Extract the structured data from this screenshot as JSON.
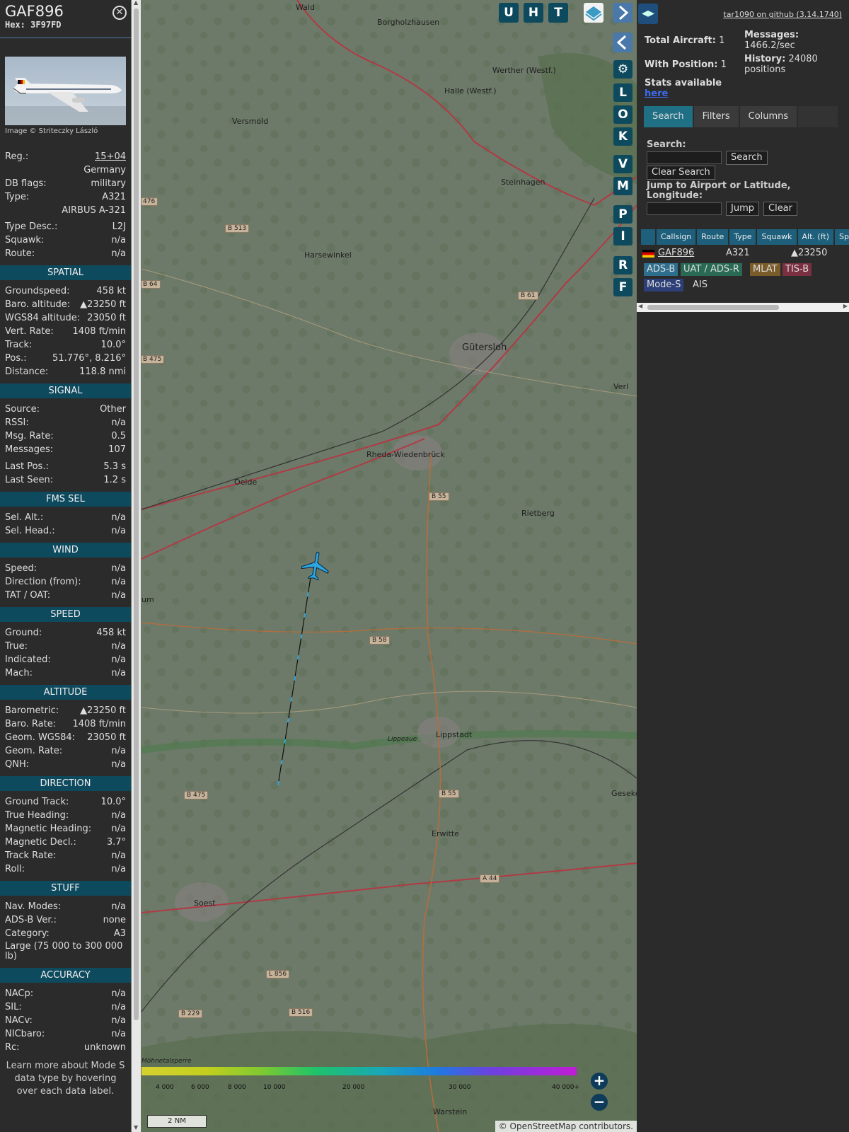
{
  "aircraft": {
    "callsign": "GAF896",
    "hex_label": "Hex:",
    "hex": "3F97FD",
    "photo_credit": "Image © Striteczky László"
  },
  "basic": [
    {
      "label": "Reg.:",
      "value": "15+04"
    },
    {
      "label": "",
      "value": "Germany"
    },
    {
      "label": "DB flags:",
      "value": "military"
    },
    {
      "label": "Type:",
      "value": "A321"
    },
    {
      "label": "",
      "value": "AIRBUS A-321"
    },
    {
      "label": "Type Desc.:",
      "value": "L2J"
    },
    {
      "label": "Squawk:",
      "value": "n/a"
    },
    {
      "label": "Route:",
      "value": "n/a"
    }
  ],
  "sections": [
    {
      "title": "SPATIAL",
      "rows": [
        {
          "label": "Groundspeed:",
          "value": "458 kt"
        },
        {
          "label": "Baro. altitude:",
          "value": "▲23250 ft"
        },
        {
          "label": "WGS84 altitude:",
          "value": "23050 ft"
        },
        {
          "label": "Vert. Rate:",
          "value": "1408 ft/min"
        },
        {
          "label": "Track:",
          "value": "10.0°"
        },
        {
          "label": "Pos.:",
          "value": "51.776°, 8.216°"
        },
        {
          "label": "Distance:",
          "value": "118.8 nmi"
        }
      ]
    },
    {
      "title": "SIGNAL",
      "rows": [
        {
          "label": "Source:",
          "value": "Other"
        },
        {
          "label": "RSSI:",
          "value": "n/a"
        },
        {
          "label": "Msg. Rate:",
          "value": "0.5"
        },
        {
          "label": "Messages:",
          "value": "107"
        },
        {
          "label": "Last Pos.:",
          "value": "5.3 s"
        },
        {
          "label": "Last Seen:",
          "value": "1.2 s"
        }
      ]
    },
    {
      "title": "FMS SEL",
      "rows": [
        {
          "label": "Sel. Alt.:",
          "value": "n/a"
        },
        {
          "label": "Sel. Head.:",
          "value": "n/a"
        }
      ]
    },
    {
      "title": "WIND",
      "rows": [
        {
          "label": "Speed:",
          "value": "n/a"
        },
        {
          "label": "Direction (from):",
          "value": "n/a"
        },
        {
          "label": "TAT / OAT:",
          "value": "n/a"
        }
      ]
    },
    {
      "title": "SPEED",
      "rows": [
        {
          "label": "Ground:",
          "value": "458 kt"
        },
        {
          "label": "True:",
          "value": "n/a"
        },
        {
          "label": "Indicated:",
          "value": "n/a"
        },
        {
          "label": "Mach:",
          "value": "n/a"
        }
      ]
    },
    {
      "title": "ALTITUDE",
      "rows": [
        {
          "label": "Barometric:",
          "value": "▲23250 ft"
        },
        {
          "label": "Baro. Rate:",
          "value": "1408 ft/min"
        },
        {
          "label": "Geom. WGS84:",
          "value": "23050 ft"
        },
        {
          "label": "Geom. Rate:",
          "value": "n/a"
        },
        {
          "label": "QNH:",
          "value": "n/a"
        }
      ]
    },
    {
      "title": "DIRECTION",
      "rows": [
        {
          "label": "Ground Track:",
          "value": "10.0°"
        },
        {
          "label": "True Heading:",
          "value": "n/a"
        },
        {
          "label": "Magnetic Heading:",
          "value": "n/a"
        },
        {
          "label": "Magnetic Decl.:",
          "value": "3.7°"
        },
        {
          "label": "Track Rate:",
          "value": "n/a"
        },
        {
          "label": "Roll:",
          "value": "n/a"
        }
      ]
    },
    {
      "title": "STUFF",
      "rows": [
        {
          "label": "Nav. Modes:",
          "value": "n/a"
        },
        {
          "label": "ADS-B Ver.:",
          "value": "none"
        },
        {
          "label": "Category:",
          "value": "A3"
        }
      ],
      "note": "Large (75 000 to 300 000 lb)"
    },
    {
      "title": "ACCURACY",
      "rows": [
        {
          "label": "NACp:",
          "value": "n/a"
        },
        {
          "label": "SIL:",
          "value": "n/a"
        },
        {
          "label": "NACv:",
          "value": "n/a"
        },
        {
          "label": "NICbaro:",
          "value": "n/a"
        },
        {
          "label": "Rc:",
          "value": "unknown"
        }
      ]
    }
  ],
  "footer_text": "Learn more about Mode S data type by hovering over each data label.",
  "map": {
    "places": [
      "Wald",
      "Borgholzhausen",
      "Werther (Westf.)",
      "Halle (Westf.)",
      "Versmold",
      "Steinhagen",
      "Harsewinkel",
      "Gütersloh",
      "Verl",
      "Rheda-Wiedenbrück",
      "Oelde",
      "Rietberg",
      "Lippstadt",
      "Erwitte",
      "Soest",
      "Warstein",
      "Geseke",
      "Lippeaue",
      "Möhnetalsperre",
      "um"
    ],
    "roads": [
      "B 513",
      "B 61",
      "B 64",
      "B 475",
      "B 55",
      "B 58",
      "B 475",
      "B 55",
      "A 44",
      "L 856",
      "B 229",
      "B 516",
      "476"
    ],
    "buttons": [
      "U",
      "H",
      "T",
      "L",
      "O",
      "K",
      "V",
      "M",
      "P",
      "I",
      "R",
      "F"
    ],
    "colorbar_labels": [
      "4 000",
      "6 000",
      "8 000",
      "10 000",
      "20 000",
      "30 000",
      "40 000+"
    ],
    "scale": "2 NM",
    "attribution": "© OpenStreetMap contributors.",
    "zoom_in": "+",
    "zoom_out": "−"
  },
  "panel": {
    "version_link": "tar1090 on github (3.14.1740)",
    "total_aircraft_label": "Total Aircraft:",
    "total_aircraft": "1",
    "with_position_label": "With Position:",
    "with_position": "1",
    "messages_label": "Messages:",
    "messages_rate": "1466.2/sec",
    "history_label": "History:",
    "history_value": "24080",
    "history_unit": "positions",
    "stats_text": "Stats available",
    "stats_link": "here",
    "tabs": [
      "Search",
      "Filters",
      "Columns"
    ],
    "search_label": "Search:",
    "search_button": "Search",
    "clear_search_button": "Clear Search",
    "jump_label": "Jump to Airport or Latitude, Longitude:",
    "jump_button": "Jump",
    "clear_button": "Clear",
    "columns": [
      "",
      "Callsign",
      "Route",
      "Type",
      "Squawk",
      "Alt. (ft)",
      "Spd"
    ],
    "row": {
      "callsign": "GAF896",
      "type": "A321",
      "alt": "▲23250"
    },
    "sources": [
      {
        "label": "ADS-B",
        "color": "#2e6f8e"
      },
      {
        "label": "UAT / ADS-R",
        "color": "#2a6a55"
      },
      {
        "label": "MLAT",
        "color": "#7a5c2a"
      },
      {
        "label": "TIS-B",
        "color": "#7a3040"
      },
      {
        "label": "Mode-S",
        "color": "#2d3f78"
      },
      {
        "label": "AIS",
        "color": ""
      }
    ]
  },
  "colors": {
    "accent": "#0e4a5e",
    "aircraft": "#2ea5e0",
    "trail": "#1e9ee0"
  }
}
